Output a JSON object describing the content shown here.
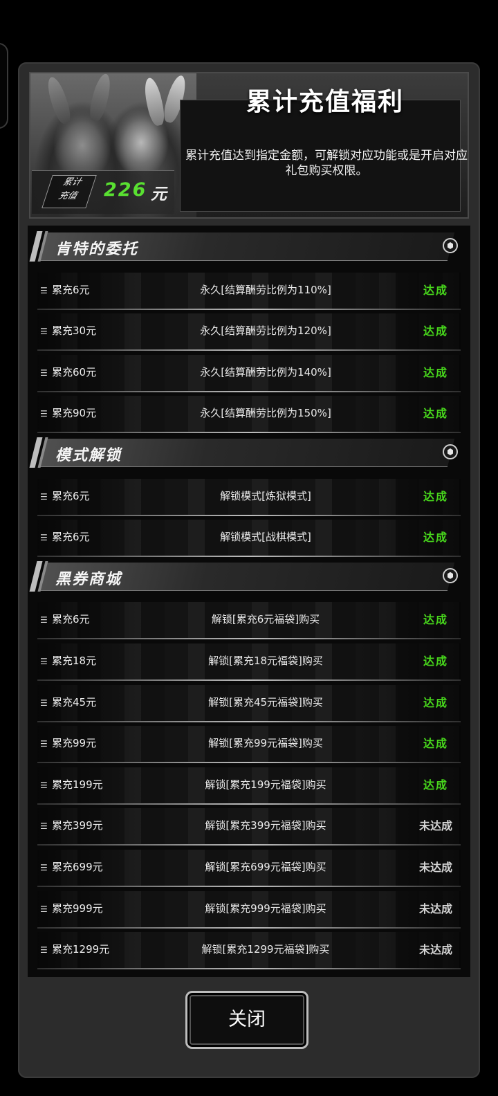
{
  "header": {
    "title": "累计充值福利",
    "description": "累计充值达到指定金额，可解锁对应功能或是开启对应礼包购买权限。",
    "total_label_line1": "累计",
    "total_label_line2": "充值",
    "total_value": "226",
    "total_unit": "元"
  },
  "sections": [
    {
      "title": "肯特的委托",
      "rows": [
        {
          "condition": "累充6元",
          "reward": "永久[结算酬劳比例为110%]",
          "status": "达成"
        },
        {
          "condition": "累充30元",
          "reward": "永久[结算酬劳比例为120%]",
          "status": "达成"
        },
        {
          "condition": "累充60元",
          "reward": "永久[结算酬劳比例为140%]",
          "status": "达成"
        },
        {
          "condition": "累充90元",
          "reward": "永久[结算酬劳比例为150%]",
          "status": "达成"
        }
      ]
    },
    {
      "title": "模式解锁",
      "rows": [
        {
          "condition": "累充6元",
          "reward": "解锁模式[炼狱模式]",
          "status": "达成"
        },
        {
          "condition": "累充6元",
          "reward": "解锁模式[战棋模式]",
          "status": "达成"
        }
      ]
    },
    {
      "title": "黑券商城",
      "rows": [
        {
          "condition": "累充6元",
          "reward": "解锁[累充6元福袋]购买",
          "status": "达成"
        },
        {
          "condition": "累充18元",
          "reward": "解锁[累充18元福袋]购买",
          "status": "达成"
        },
        {
          "condition": "累充45元",
          "reward": "解锁[累充45元福袋]购买",
          "status": "达成"
        },
        {
          "condition": "累充99元",
          "reward": "解锁[累充99元福袋]购买",
          "status": "达成"
        },
        {
          "condition": "累充199元",
          "reward": "解锁[累充199元福袋]购买",
          "status": "达成"
        },
        {
          "condition": "累充399元",
          "reward": "解锁[累充399元福袋]购买",
          "status": "未达成"
        },
        {
          "condition": "累充699元",
          "reward": "解锁[累充699元福袋]购买",
          "status": "未达成"
        },
        {
          "condition": "累充999元",
          "reward": "解锁[累充999元福袋]购买",
          "status": "未达成"
        },
        {
          "condition": "累充1299元",
          "reward": "解锁[累充1299元福袋]购买",
          "status": "未达成"
        }
      ]
    }
  ],
  "footer": {
    "close_label": "关闭"
  },
  "icons": {
    "row_icon": "layers-icon",
    "section_badge": "hexagon-badge-icon"
  },
  "colors": {
    "done": "#48d81c",
    "todo": "#d6d6d6",
    "total_value": "#59e031"
  }
}
